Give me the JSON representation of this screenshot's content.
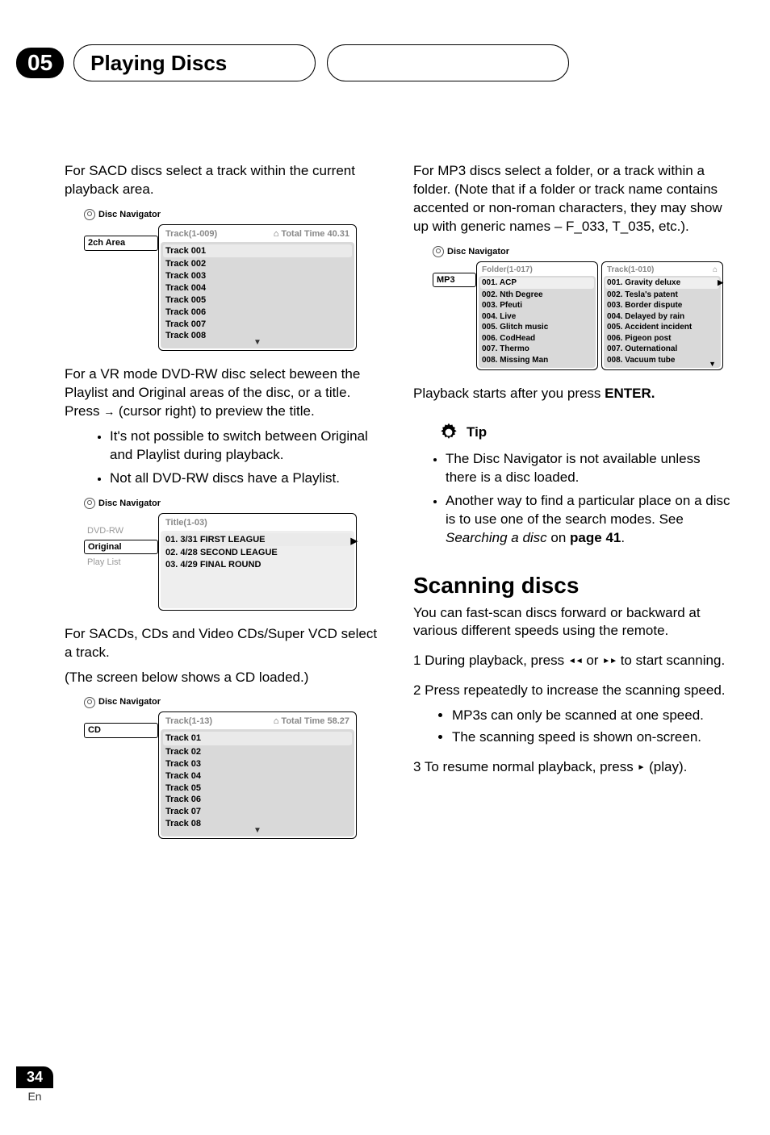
{
  "chapter": "05",
  "title": "Playing Discs",
  "left": {
    "p1": "For SACD discs select a track within the current playback area.",
    "nav1": {
      "heading": "Disc Navigator",
      "left_label": "2ch Area",
      "hdr_l": "Track(1-009)",
      "hdr_r": "Total Time   40.31",
      "items": [
        "Track 001",
        "Track 002",
        "Track 003",
        "Track 004",
        "Track 005",
        "Track 006",
        "Track 007",
        "Track 008"
      ]
    },
    "p2a": "For a VR mode DVD-RW disc select beween the Playlist and Original areas of the disc, or a title. Press ",
    "p2b": " (cursor right) to preview the title.",
    "b1": "It's not possible to switch between Original and Playlist during playback.",
    "b2": "Not all DVD-RW discs have a Playlist.",
    "nav2": {
      "heading": "Disc Navigator",
      "left1": "DVD-RW",
      "left2": "Original",
      "left3": "Play List",
      "hdr": "Title(1-03)",
      "items": [
        "01. 3/31 FIRST LEAGUE",
        "02. 4/28 SECOND LEAGUE",
        "03. 4/29 FINAL ROUND"
      ]
    },
    "p3": "For SACDs, CDs and Video CDs/Super VCD select a track.",
    "p4": "(The screen below shows a CD loaded.)",
    "nav3": {
      "heading": "Disc Navigator",
      "left_label": "CD",
      "hdr_l": "Track(1-13)",
      "hdr_r": "Total Time   58.27",
      "items": [
        "Track 01",
        "Track 02",
        "Track 03",
        "Track 04",
        "Track 05",
        "Track 06",
        "Track 07",
        "Track 08"
      ]
    }
  },
  "right": {
    "p1": "For MP3 discs select a folder, or a  track within a folder. (Note that if a folder or track name contains accented or non-roman characters, they may show up with generic names – F_033, T_035, etc.).",
    "nav4": {
      "heading": "Disc Navigator",
      "left_label": "MP3",
      "col1_hdr": "Folder(1-017)",
      "col1": [
        "001. ACP",
        "002. Nth Degree",
        "003. Pfeuti",
        "004. Live",
        "005. Glitch music",
        "006. CodHead",
        "007. Thermo",
        "008. Missing Man"
      ],
      "col2_hdr": "Track(1-010)",
      "col2": [
        "001. Gravity deluxe",
        "002. Tesla's patent",
        "003. Border dispute",
        "004. Delayed by rain",
        "005. Accident incident",
        "006. Pigeon post",
        "007. Outernational",
        "008. Vacuum tube"
      ]
    },
    "p2a": "Playback starts after you press ",
    "p2b": "ENTER.",
    "tip_label": "Tip",
    "tip1": "The Disc Navigator is not available unless there is a disc loaded.",
    "tip2a": "Another way to find a particular place on a disc is to use one of the search modes. See ",
    "tip2b": "Searching a disc",
    "tip2c": " on ",
    "tip2d": "page 41",
    "tip2e": ".",
    "h2": "Scanning discs",
    "p3": "You can fast-scan discs forward or backward at various different speeds using the remote.",
    "s1a": "1    During playback, press ",
    "s1b": " or ",
    "s1c": " to start scanning.",
    "s2": "2    Press repeatedly to increase the scanning speed.",
    "s2b1": "MP3s can only be scanned at one speed.",
    "s2b2": "The scanning speed is shown on-screen.",
    "s3a": "3    To resume normal playback, press ",
    "s3b": " (play)."
  },
  "page_num": "34",
  "page_lang": "En"
}
